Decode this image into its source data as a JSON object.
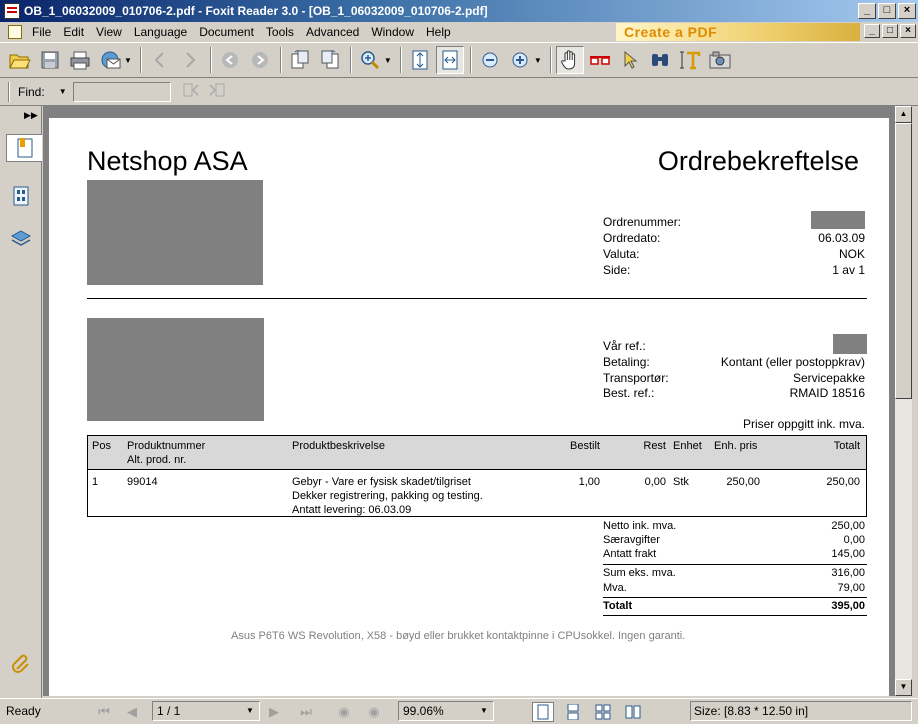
{
  "window": {
    "title": "OB_1_06032009_010706-2.pdf - Foxit Reader 3.0 - [OB_1_06032009_010706-2.pdf]",
    "buttons": {
      "minimize": "_",
      "maximize": "□",
      "close": "×"
    }
  },
  "menubar": {
    "items": [
      {
        "label": "File"
      },
      {
        "label": "Edit"
      },
      {
        "label": "View"
      },
      {
        "label": "Language"
      },
      {
        "label": "Document"
      },
      {
        "label": "Tools"
      },
      {
        "label": "Advanced"
      },
      {
        "label": "Window"
      },
      {
        "label": "Help"
      }
    ],
    "banner": "Create a PDF"
  },
  "findbar": {
    "label": "Find:",
    "value": ""
  },
  "document": {
    "company": "Netshop ASA",
    "title": "Ordrebekreftelse",
    "meta": [
      {
        "label": "Ordrenummer:",
        "value": ""
      },
      {
        "label": "Ordredato:",
        "value": "06.03.09"
      },
      {
        "label": "Valuta:",
        "value": "NOK"
      },
      {
        "label": "Side:",
        "value": "1 av 1"
      }
    ],
    "refs": [
      {
        "label": "Vår ref.:",
        "value": ""
      },
      {
        "label": "Betaling:",
        "value": "Kontant (eller postoppkrav)"
      },
      {
        "label": "Transportør:",
        "value": "Servicepakke"
      },
      {
        "label": "Best. ref.:",
        "value": "RMAID 18516"
      }
    ],
    "price_note": "Priser oppgitt ink. mva.",
    "table": {
      "headers": {
        "pos": "Pos",
        "product": "Produktnummer",
        "alt": "Alt. prod. nr.",
        "desc": "Produktbeskrivelse",
        "ordered": "Bestilt",
        "rest": "Rest",
        "unit": "Enhet",
        "unit_price": "Enh. pris",
        "total": "Totalt"
      },
      "rows": [
        {
          "pos": "1",
          "product": "99014",
          "desc1": "Gebyr - Vare er fysisk skadet/tilgriset",
          "desc2": "Dekker registrering, pakking og testing.",
          "desc3": "Antatt levering: 06.03.09",
          "ordered": "1,00",
          "rest": "0,00",
          "unit": "Stk",
          "unit_price": "250,00",
          "total": "250,00"
        }
      ]
    },
    "totals": [
      {
        "label": "Netto ink. mva.",
        "value": "250,00"
      },
      {
        "label": "Særavgifter",
        "value": "0,00"
      },
      {
        "label": "Antatt frakt",
        "value": "145,00"
      },
      {
        "label": "Sum eks. mva.",
        "value": "316,00"
      },
      {
        "label": "Mva.",
        "value": "79,00"
      },
      {
        "label": "Totalt",
        "value": "395,00"
      }
    ],
    "footer_note": "Asus P6T6 WS Revolution, X58 - bøyd eller brukket kontaktpinne i CPUsokkel. Ingen garanti."
  },
  "statusbar": {
    "status": "Ready",
    "page": "1 / 1",
    "zoom": "99.06%",
    "size": "Size: [8.83 * 12.50 in]"
  }
}
